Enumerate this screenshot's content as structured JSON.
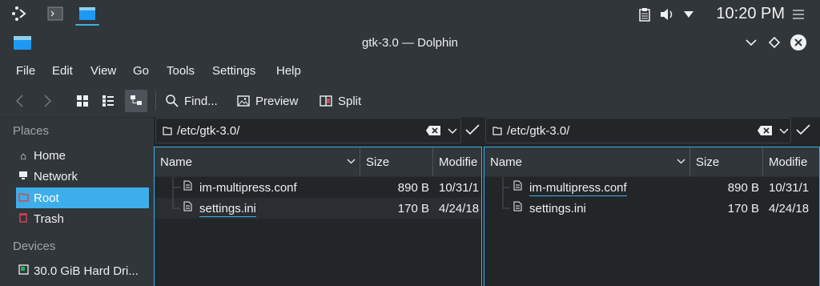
{
  "panel": {
    "clock": "10:20 PM"
  },
  "window": {
    "title": "gtk-3.0 — Dolphin"
  },
  "menu": [
    "File",
    "Edit",
    "View",
    "Go",
    "Tools",
    "Settings",
    "Help"
  ],
  "toolbar": {
    "find_label": "Find...",
    "preview_label": "Preview",
    "split_label": "Split"
  },
  "sidebar": {
    "places_heading": "Places",
    "places": [
      {
        "label": "Home",
        "icon": "home-icon"
      },
      {
        "label": "Network",
        "icon": "network-icon"
      },
      {
        "label": "Root",
        "icon": "folder-icon",
        "selected": true
      },
      {
        "label": "Trash",
        "icon": "trash-icon"
      }
    ],
    "devices_heading": "Devices",
    "devices": [
      {
        "label": "30.0 GiB Hard Dri...",
        "icon": "harddrive-icon"
      }
    ]
  },
  "left_pane": {
    "path": "/etc/gtk-3.0/",
    "columns": [
      "Name",
      "Size",
      "Modifie"
    ],
    "files": [
      {
        "name": "im-multipress.conf",
        "size": "890 B",
        "modified": "10/31/1"
      },
      {
        "name": "settings.ini",
        "size": "170 B",
        "modified": "4/24/18"
      }
    ]
  },
  "right_pane": {
    "path": "/etc/gtk-3.0/",
    "columns": [
      "Name",
      "Size",
      "Modifie"
    ],
    "files": [
      {
        "name": "im-multipress.conf",
        "size": "890 B",
        "modified": "10/31/1"
      },
      {
        "name": "settings.ini",
        "size": "170 B",
        "modified": "4/24/18"
      }
    ]
  },
  "colors": {
    "accent": "#3daee9",
    "window_bg": "#31363b",
    "view_bg": "#232629",
    "text": "#eff0f1"
  }
}
